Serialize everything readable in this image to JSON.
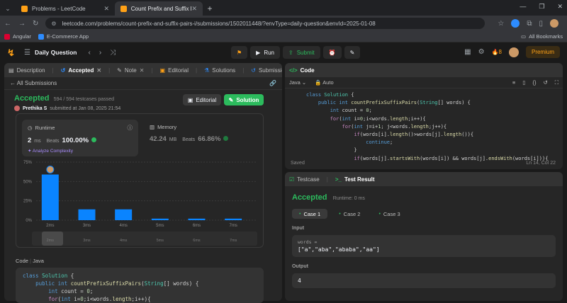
{
  "browser": {
    "tabs": [
      {
        "title": "Problems - LeetCode",
        "active": false
      },
      {
        "title": "Count Prefix and Suffix Pairs I -",
        "active": true
      }
    ],
    "url": "leetcode.com/problems/count-prefix-and-suffix-pairs-i/submissions/1502011448/?envType=daily-question&envId=2025-01-08",
    "bookmarks": [
      "Angular",
      "E-Commerce App"
    ],
    "all_bookmarks": "All Bookmarks"
  },
  "nav": {
    "title": "Daily Question",
    "run": "Run",
    "submit": "Submit",
    "streak": "8",
    "premium": "Premium"
  },
  "left_tabs": [
    "Description",
    "Accepted",
    "Note",
    "Editorial",
    "Solutions",
    "Submissions"
  ],
  "submission": {
    "back_label": "All Submissions",
    "status": "Accepted",
    "testcases": "594 / 594 testcases passed",
    "author": "Prethika S",
    "submitted_at": "submitted at Jan 08, 2025 21:54",
    "editorial_btn": "Editorial",
    "solution_btn": "Solution"
  },
  "runtime": {
    "label": "Runtime",
    "value": "2",
    "unit": "ms",
    "beats_label": "Beats",
    "beats": "100.00%",
    "analyze": "Analyze Complexity"
  },
  "memory": {
    "label": "Memory",
    "value": "42.24",
    "unit": "MB",
    "beats_label": "Beats",
    "beats": "66.86%"
  },
  "chart_data": {
    "type": "bar",
    "categories": [
      "2ms",
      "3ms",
      "4ms",
      "5ms",
      "6ms",
      "7ms"
    ],
    "values": [
      59,
      14,
      14,
      2,
      2,
      2
    ],
    "yticks": [
      "75%",
      "50%",
      "25%",
      "0%"
    ],
    "ylim": [
      0,
      75
    ],
    "highlight": "2ms",
    "bar_color": "#0a84ff"
  },
  "code_section": {
    "label": "Code",
    "lang": "Java",
    "lines": [
      "class Solution {",
      "    public int countPrefixSuffixPairs(String[] words) {",
      "        int count = 0;",
      "        for(int i=0;i<words.length;i++){"
    ]
  },
  "editor": {
    "tab": "Code",
    "lang": "Java",
    "mode": "Auto",
    "lines": [
      "class Solution {",
      "    public int countPrefixSuffixPairs(String[] words) {",
      "        int count = 0;",
      "        for(int i=0;i<words.length;i++){",
      "            for(int j=i+1; j<words.length;j++){",
      "                if(words[i].length()>words[j].length()){",
      "                    continue;",
      "                }",
      "                if(words[j].startsWith(words[i]) && words[j].endsWith(words[i])){"
    ],
    "status": "Saved",
    "position": "Ln 14, Col 22"
  },
  "result": {
    "tabs": [
      "Testcase",
      "Test Result"
    ],
    "status": "Accepted",
    "runtime": "Runtime: 0 ms",
    "cases": [
      "Case 1",
      "Case 2",
      "Case 3"
    ],
    "input_label": "Input",
    "input_var": "words =",
    "input_value": "[\"a\",\"aba\",\"ababa\",\"aa\"]",
    "output_label": "Output",
    "output_value": "4"
  }
}
